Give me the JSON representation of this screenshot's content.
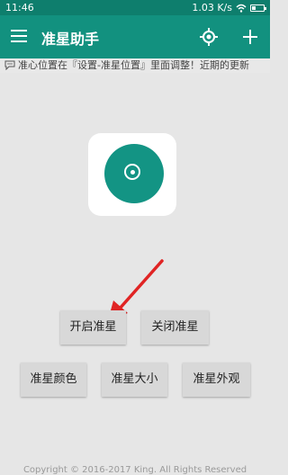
{
  "status": {
    "time": "11:46",
    "speed": "1.03 K/s"
  },
  "toolbar": {
    "title": "准星助手",
    "menu_icon": "menu-icon",
    "locate_icon": "crosshair-target-icon",
    "add_icon": "add-icon"
  },
  "notice": {
    "icon": "chat-bubble-icon",
    "text": "准心位置在『设置-准星位置』里面调整！近期的更新"
  },
  "logo": {
    "icon": "crosshair-logo-icon",
    "color": "#139484"
  },
  "buttons": {
    "enable": "开启准星",
    "disable": "关闭准星",
    "color": "准星颜色",
    "size": "准星大小",
    "appearance": "准星外观"
  },
  "annotation": {
    "arrow_color": "#e02424"
  },
  "footer": {
    "copyright": "Copyright © 2016-2017 King. All Rights Reserved"
  },
  "colors": {
    "statusbar": "#0e7e6d",
    "appbar": "#12917f",
    "background": "#e6e6e6",
    "button": "#d8d8d8"
  }
}
